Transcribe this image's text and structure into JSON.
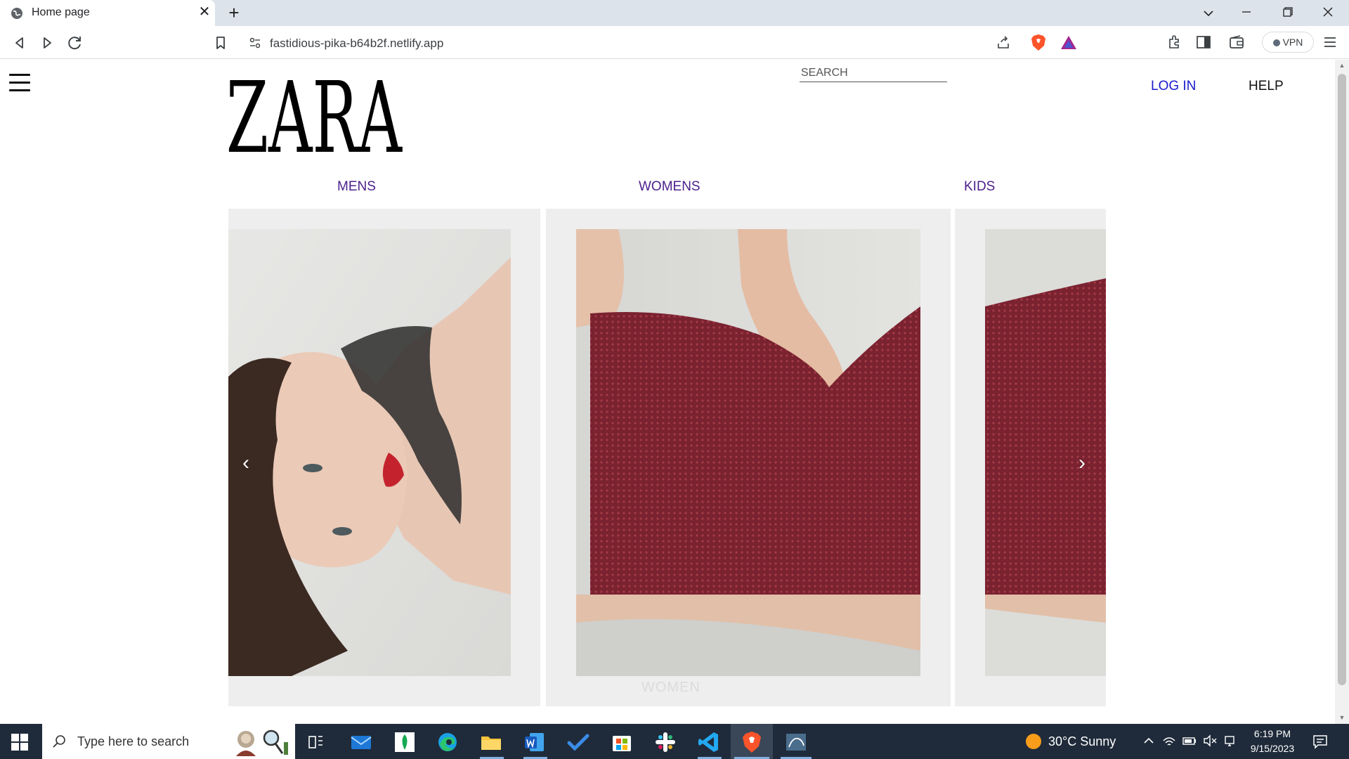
{
  "browser": {
    "tab_title": "Home page",
    "url": "fastidious-pika-b64b2f.netlify.app",
    "vpn_label": "VPN"
  },
  "site": {
    "logo_text": "ZARA",
    "search_placeholder": "SEARCH",
    "login_label": "LOG IN",
    "help_label": "HELP",
    "categories": [
      "MENS",
      "WOMENS",
      "KIDS"
    ],
    "carousel": {
      "prev_label": "‹",
      "next_label": "›",
      "panel_caption": "WOMEN"
    }
  },
  "taskbar": {
    "search_placeholder": "Type here to search",
    "weather": "30°C  Sunny",
    "time": "6:19 PM",
    "date": "9/15/2023"
  },
  "colors": {
    "login": "#1a1acc",
    "categories": "#4b1f8a",
    "dress": "#7a2230",
    "taskbar": "#1f2b3a"
  }
}
